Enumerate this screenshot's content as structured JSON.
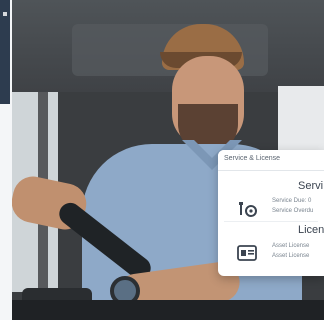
{
  "card": {
    "title": "Service & License",
    "service": {
      "title": "Servi",
      "lines": [
        "Service Due: 0",
        "Service Overdu"
      ]
    },
    "license": {
      "title": "Licen",
      "lines": [
        "Asset License",
        "Asset License"
      ]
    }
  },
  "colors": {
    "card_bg": "#ffffff",
    "text_dark": "#3b4450",
    "text_muted": "#7a848f",
    "rail_tab": "#2d3c4f"
  },
  "icons": [
    "wrench-gear-icon",
    "license-card-icon"
  ]
}
